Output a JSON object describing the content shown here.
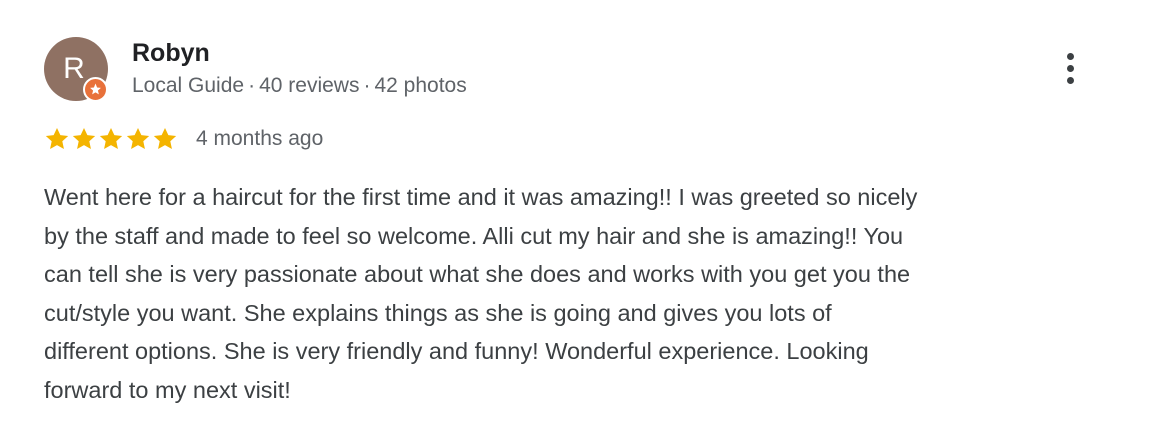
{
  "reviewer": {
    "name": "Robyn",
    "initial": "R",
    "avatar_color": "#8f7163",
    "badge_color": "#e8713a",
    "badge_icon": "local-guide-star-icon",
    "level": "Local Guide",
    "reviews": "40 reviews",
    "photos": "42 photos",
    "separator": "·"
  },
  "rating": {
    "stars": 5,
    "max": 5,
    "star_color": "#f4b400",
    "time": "4 months ago"
  },
  "review": {
    "lines": [
      "Went here for a haircut for the first time and it was amazing!! I was greeted so nicely",
      "by the staff and made to feel so welcome. Alli cut my hair and she is amazing!! You",
      "can tell she is very passionate about what she does and works with you get you the",
      "cut/style you want. She explains things as she is going and gives you lots of",
      "different options. She is very friendly and funny! Wonderful experience. Looking",
      "forward to my next visit!"
    ]
  },
  "menu": {
    "icon": "more-vertical-icon"
  }
}
